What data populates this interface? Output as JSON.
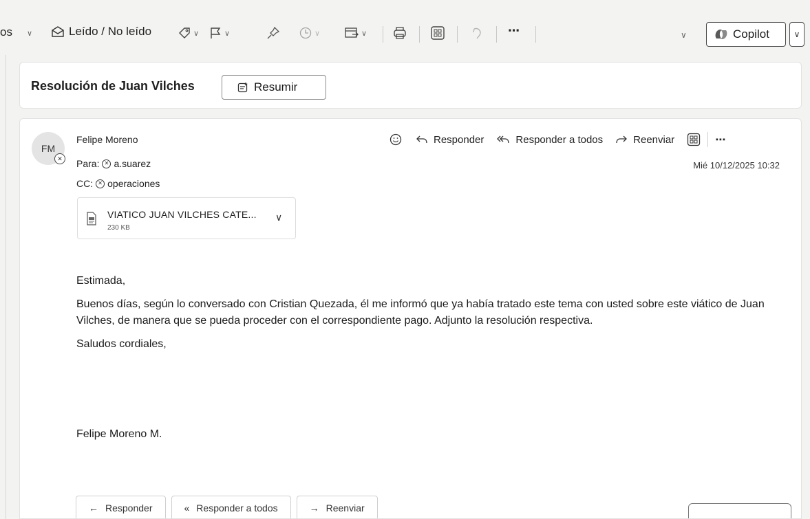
{
  "toolbar": {
    "partial_left": "os",
    "read_unread": "Leído / No leído",
    "copilot_label": "Copilot",
    "icons": [
      "envelope-open-icon",
      "tag-icon",
      "flag-icon",
      "pin-icon",
      "clock-icon",
      "move-icon",
      "print-icon",
      "apps-icon",
      "undo-icon",
      "more-icon"
    ]
  },
  "subject": {
    "title": "Resolución de Juan Vilches",
    "summarize_label": "Resumir"
  },
  "message": {
    "avatar_initials": "FM",
    "sender": "Felipe Moreno",
    "to_label": "Para:",
    "to_value": "a.suarez",
    "cc_label": "CC:",
    "cc_value": "operaciones",
    "datetime": "Mié 10/12/2025 10:32",
    "actions": {
      "reply": "Responder",
      "reply_all": "Responder a todos",
      "forward": "Reenviar"
    },
    "attachment": {
      "name": "VIATICO JUAN VILCHES CATE...",
      "size": "230 KB"
    },
    "greeting": "Estimada,",
    "paragraph": "Buenos días, según lo conversado con Cristian Quezada, él me informó que ya había tratado este tema con usted sobre este viático de Juan Vilches, de manera que se pueda proceder con el correspondiente pago. Adjunto la resolución respectiva.",
    "closing": "Saludos cordiales,",
    "signature": "Felipe Moreno M."
  },
  "bottom": {
    "reply": "Responder",
    "reply_all": "Responder a todos",
    "forward": "Reenviar"
  }
}
